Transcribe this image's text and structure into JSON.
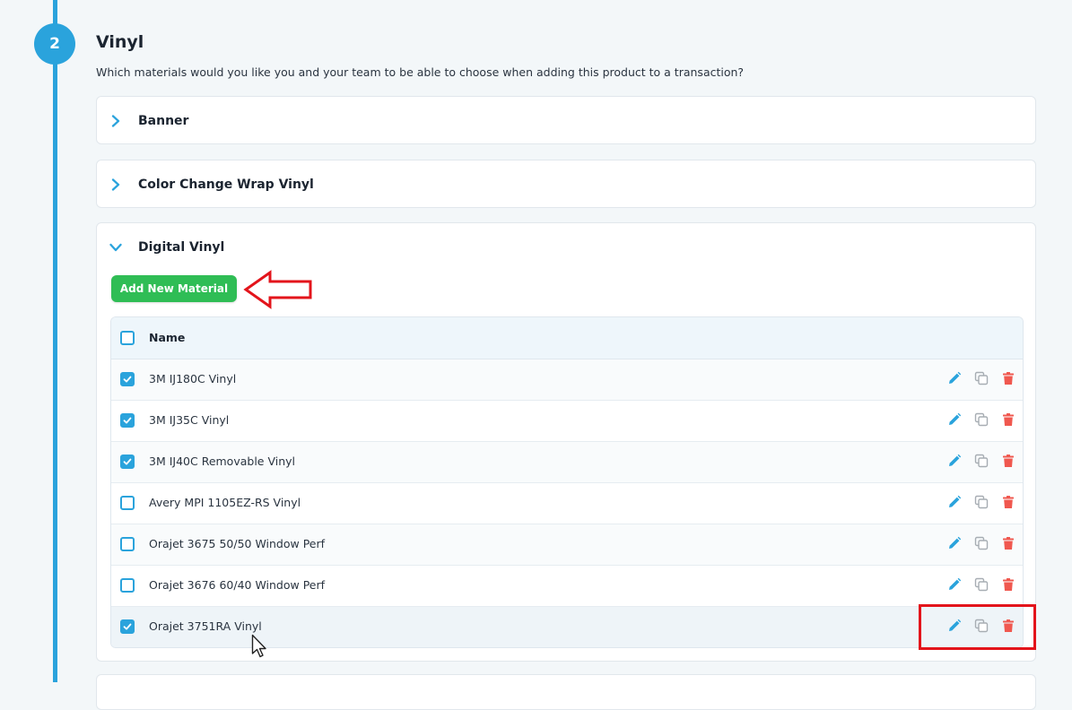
{
  "step": {
    "number": "2",
    "title": "Vinyl",
    "subtitle": "Which materials would you like you and your team to be able to choose when adding this product to a transaction?"
  },
  "categories": [
    {
      "label": "Banner",
      "expanded": false
    },
    {
      "label": "Color Change Wrap Vinyl",
      "expanded": false
    },
    {
      "label": "Digital Vinyl",
      "expanded": true
    }
  ],
  "digital_vinyl": {
    "add_button": "Add New Material",
    "table": {
      "header": "Name",
      "rows": [
        {
          "name": "3M IJ180C Vinyl",
          "checked": true
        },
        {
          "name": "3M IJ35C Vinyl",
          "checked": true
        },
        {
          "name": "3M IJ40C Removable Vinyl",
          "checked": true
        },
        {
          "name": "Avery MPI 1105EZ-RS Vinyl",
          "checked": false
        },
        {
          "name": "Orajet 3675 50/50 Window Perf",
          "checked": false
        },
        {
          "name": "Orajet 3676 60/40 Window Perf",
          "checked": false
        },
        {
          "name": "Orajet 3751RA Vinyl",
          "checked": true
        }
      ]
    }
  },
  "colors": {
    "accent": "#2aa3dc",
    "add_button": "#2fbd55",
    "delete_icon": "#f0584f",
    "annotation": "#e3141b"
  },
  "icons": {
    "edit": "pencil-icon",
    "copy": "copy-icon",
    "delete": "trash-icon"
  }
}
